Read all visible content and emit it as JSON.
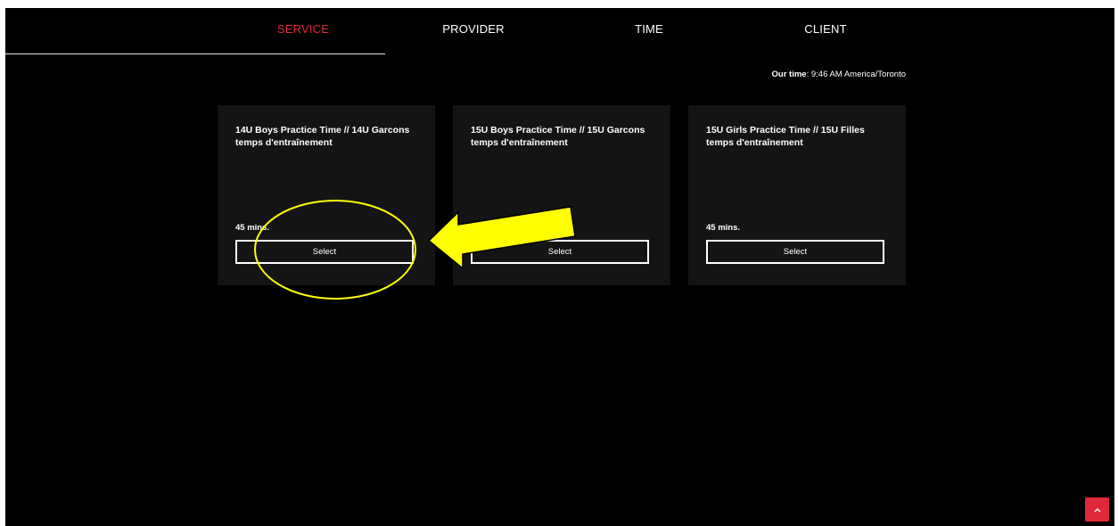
{
  "steps": [
    {
      "label": "SERVICE",
      "active": true
    },
    {
      "label": "PROVIDER",
      "active": false
    },
    {
      "label": "TIME",
      "active": false
    },
    {
      "label": "CLIENT",
      "active": false
    }
  ],
  "our_time": {
    "label": "Our time",
    "value": ": 9:46 AM America/Toronto"
  },
  "services": [
    {
      "title": "14U Boys Practice Time // 14U Garcons temps d'entraînement",
      "duration": "45 mins.",
      "button": "Select"
    },
    {
      "title": "15U Boys Practice Time // 15U Garcons temps d'entraînement",
      "duration": "",
      "button": "Select"
    },
    {
      "title": "15U Girls Practice Time // 15U Filles temps d'entraînement",
      "duration": "45 mins.",
      "button": "Select"
    }
  ],
  "colors": {
    "accent": "#e0283b",
    "background": "#000000",
    "card": "#141414",
    "annotation": "#ffff00"
  },
  "icons": {
    "scroll_top": "chevron-up-icon"
  }
}
